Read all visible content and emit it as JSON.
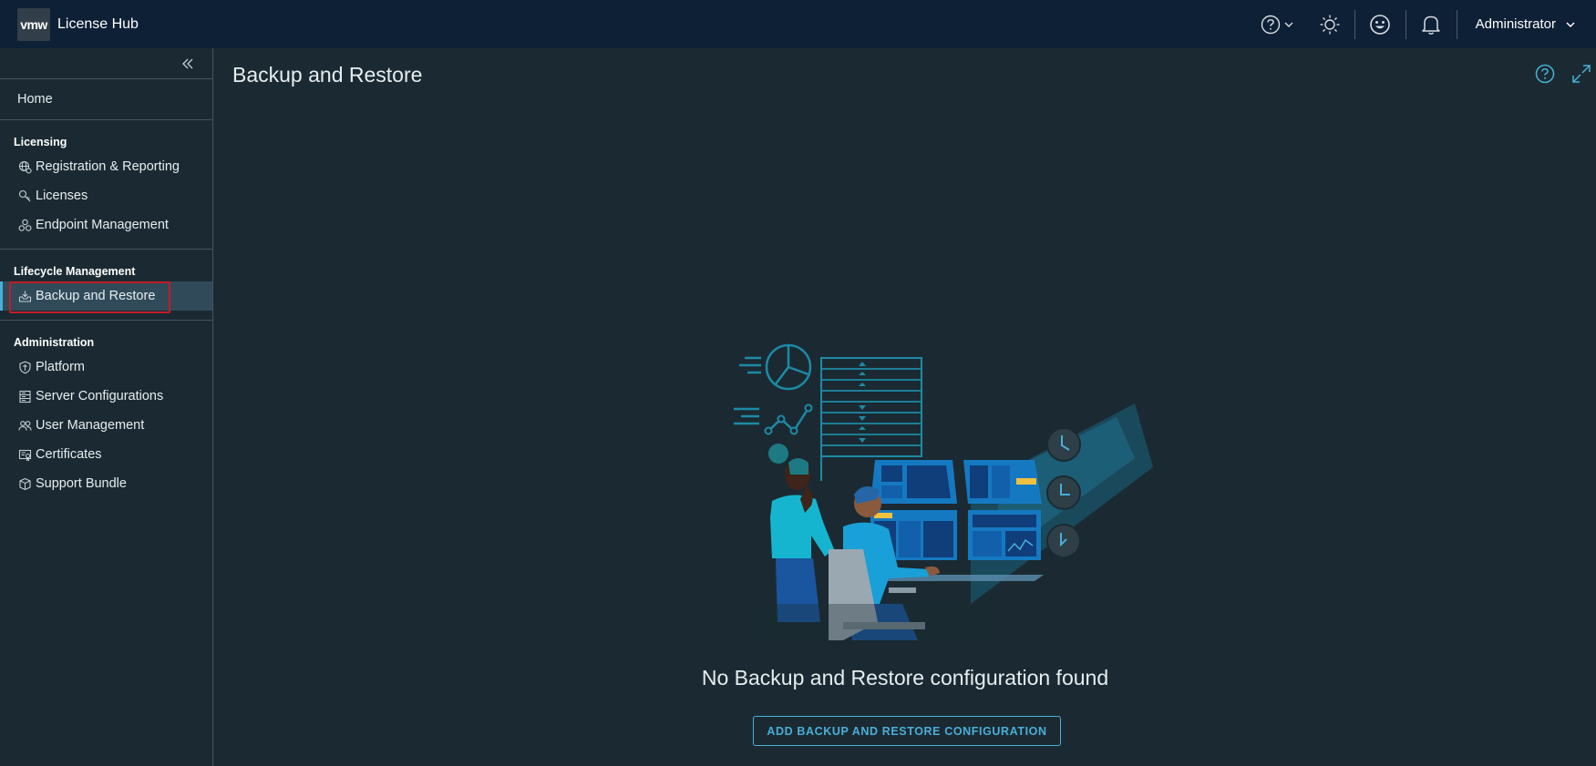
{
  "header": {
    "logo_text": "vmw",
    "app_title": "License Hub",
    "user_name": "Administrator"
  },
  "sidebar": {
    "home_label": "Home",
    "sections": [
      {
        "title": "Licensing",
        "items": [
          {
            "label": "Registration & Reporting",
            "icon": "globe-gear-icon"
          },
          {
            "label": "Licenses",
            "icon": "key-icon"
          },
          {
            "label": "Endpoint Management",
            "icon": "nodes-icon"
          }
        ]
      },
      {
        "title": "Lifecycle Management",
        "items": [
          {
            "label": "Backup and Restore",
            "icon": "backup-tray-icon",
            "active": true
          }
        ]
      },
      {
        "title": "Administration",
        "items": [
          {
            "label": "Platform",
            "icon": "shield-icon"
          },
          {
            "label": "Server Configurations",
            "icon": "server-icon"
          },
          {
            "label": "User Management",
            "icon": "users-icon"
          },
          {
            "label": "Certificates",
            "icon": "certificate-icon"
          },
          {
            "label": "Support Bundle",
            "icon": "package-icon"
          }
        ]
      }
    ]
  },
  "main": {
    "title": "Backup and Restore",
    "empty_message": "No Backup and Restore configuration found",
    "add_button_label": "ADD BACKUP AND RESTORE CONFIGURATION"
  },
  "colors": {
    "header_bg": "#0d2036",
    "body_bg": "#1b2a32",
    "accent": "#49afd9",
    "highlight": "#c21d28"
  }
}
